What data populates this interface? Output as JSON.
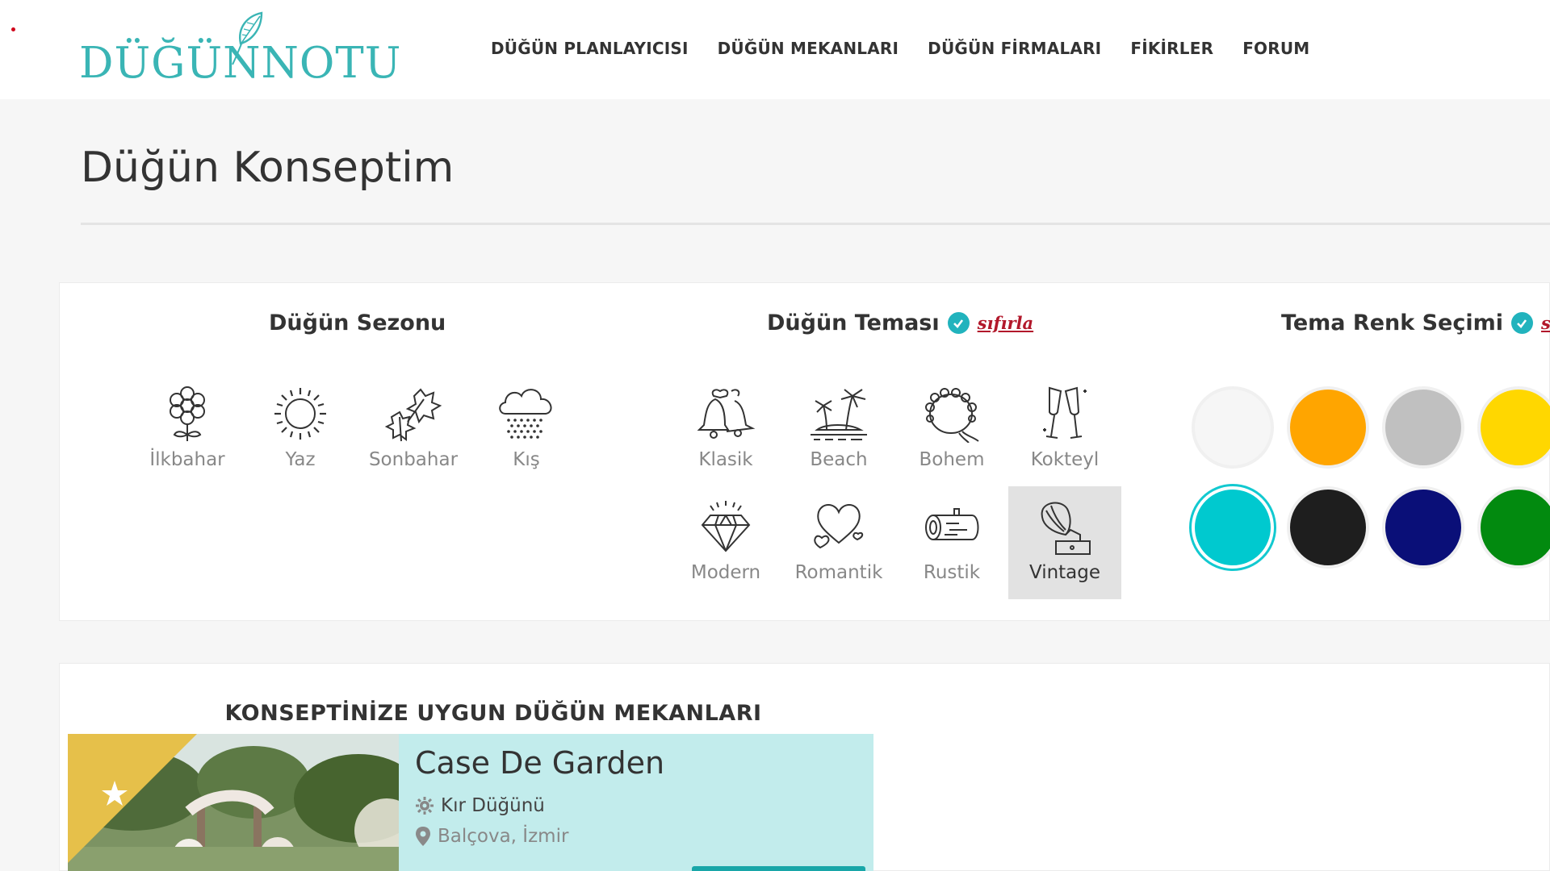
{
  "header": {
    "logo": {
      "part1": "DÜĞÜN",
      "part2": "NOTU"
    },
    "nav": [
      "DÜĞÜN PLANLAYICISI",
      "DÜĞÜN MEKANLARI",
      "DÜĞÜN FİRMALARI",
      "FİKİRLER",
      "FORUM"
    ]
  },
  "page": {
    "title": "Düğün Konseptim"
  },
  "season": {
    "title": "Düğün Sezonu",
    "items": [
      {
        "label": "İlkbahar",
        "icon": "flower-icon"
      },
      {
        "label": "Yaz",
        "icon": "sun-icon"
      },
      {
        "label": "Sonbahar",
        "icon": "autumn-leaves-icon"
      },
      {
        "label": "Kış",
        "icon": "snow-cloud-icon"
      }
    ]
  },
  "theme": {
    "title": "Düğün Teması",
    "reset": "sıfırla",
    "items": [
      {
        "label": "Klasik",
        "icon": "bells-icon"
      },
      {
        "label": "Beach",
        "icon": "palm-island-icon"
      },
      {
        "label": "Bohem",
        "icon": "flower-crown-icon"
      },
      {
        "label": "Kokteyl",
        "icon": "champagne-glasses-icon"
      },
      {
        "label": "Modern",
        "icon": "diamond-icon"
      },
      {
        "label": "Romantik",
        "icon": "hearts-icon"
      },
      {
        "label": "Rustik",
        "icon": "log-icon"
      },
      {
        "label": "Vintage",
        "icon": "gramophone-icon",
        "selected": true
      }
    ]
  },
  "colors": {
    "title": "Tema Renk Seçimi",
    "reset_partial": "s",
    "swatches": [
      {
        "color": "#f6f6f6"
      },
      {
        "color": "#ffa500"
      },
      {
        "color": "#c0c0c0"
      },
      {
        "color": "#ffd700"
      },
      {
        "color": "#00c9cf",
        "selected": true
      },
      {
        "color": "#1e1e1e"
      },
      {
        "color": "#0a0f78"
      },
      {
        "color": "#028a0f"
      }
    ]
  },
  "venues": {
    "title": "KONSEPTİNİZE UYGUN DÜĞÜN MEKANLARI",
    "items": [
      {
        "name": "Case De Garden",
        "type": "Kır Düğünü",
        "location": "Balçova, İzmir"
      }
    ]
  },
  "accent_color": "#21b3bd",
  "reset_color": "#b2182b"
}
